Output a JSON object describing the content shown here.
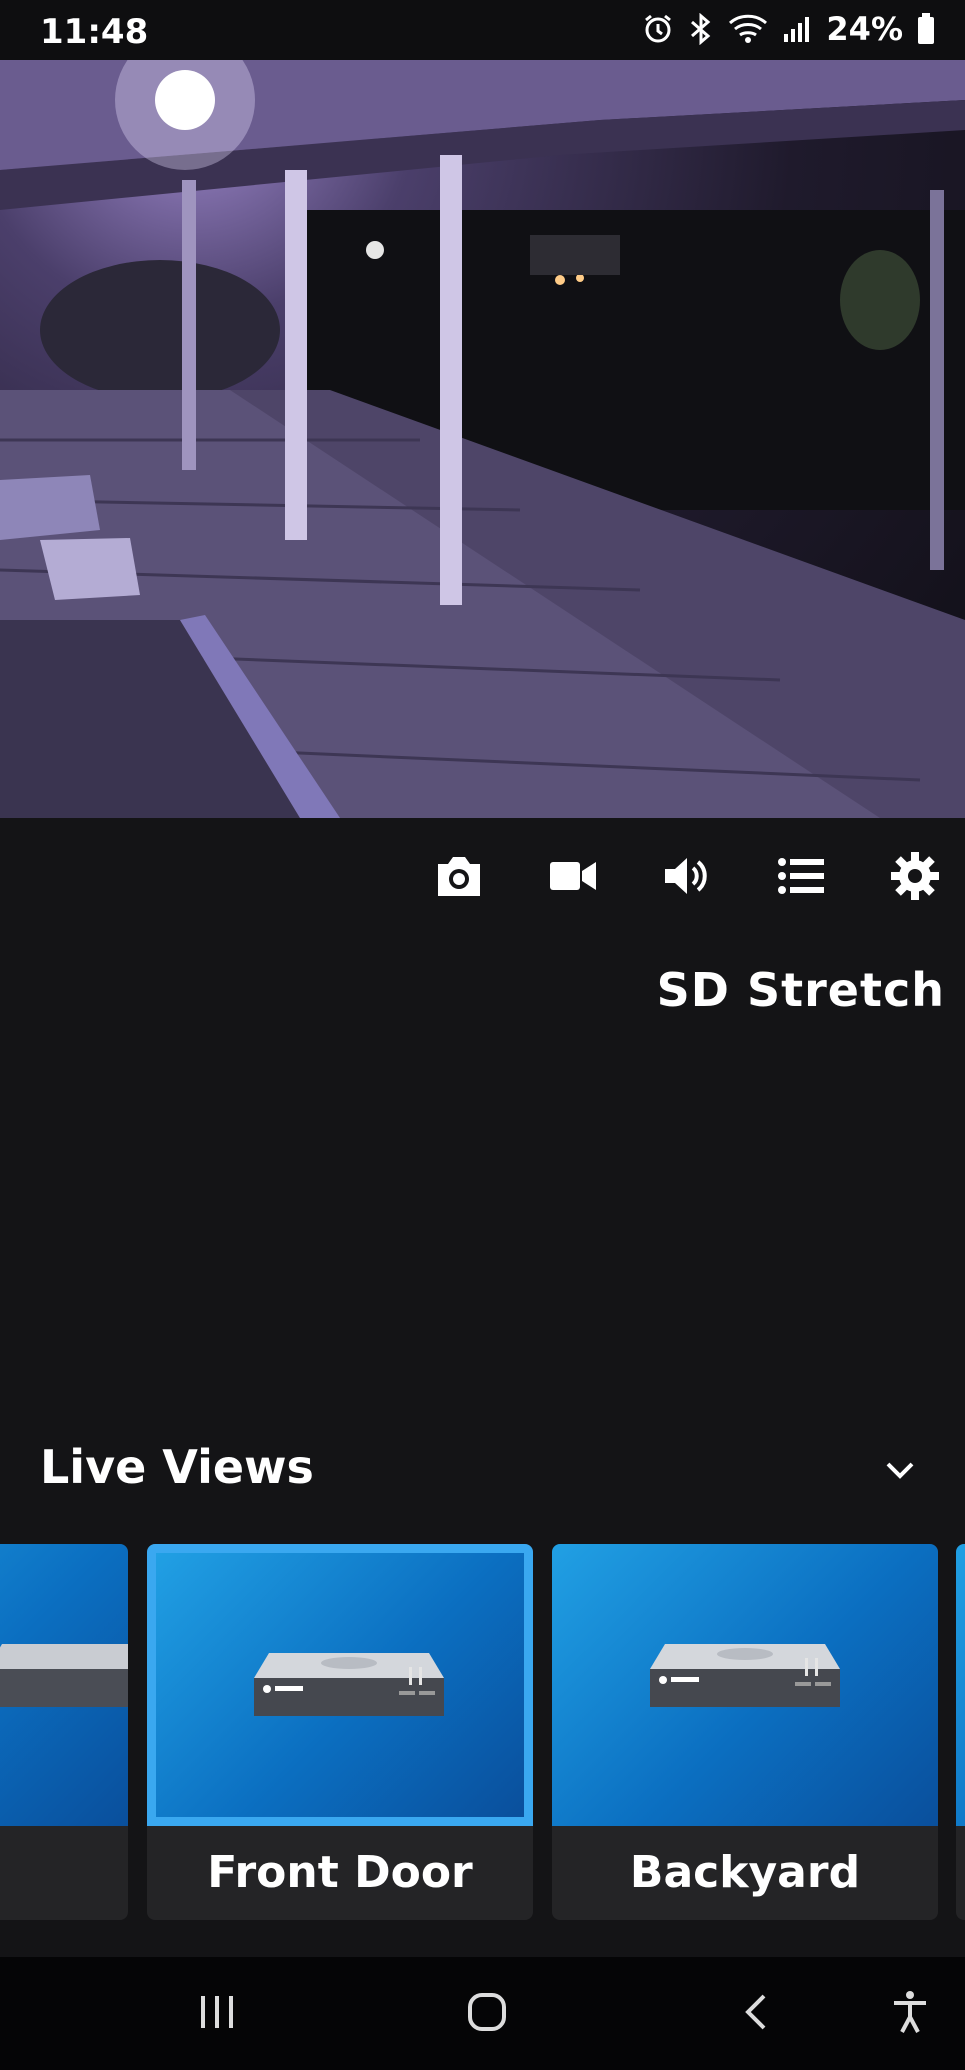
{
  "status_bar": {
    "time": "11:48",
    "battery_percent": "24%",
    "icons": [
      "alarm-icon",
      "bluetooth-icon",
      "wifi-icon",
      "signal-icon",
      "battery-icon"
    ]
  },
  "camera": {
    "view_mode": "SD Stretch"
  },
  "toolbar": {
    "icons": [
      "camera-snapshot-icon",
      "video-record-icon",
      "volume-icon",
      "list-icon",
      "settings-icon"
    ]
  },
  "live_views": {
    "title": "Live Views",
    "cards": [
      {
        "label": ""
      },
      {
        "label": "Front Door",
        "selected": true
      },
      {
        "label": "Backyard"
      }
    ]
  },
  "colors": {
    "background": "#141416",
    "accent": "#3aa8f0",
    "thumb_blue": "#0b6fc1"
  }
}
